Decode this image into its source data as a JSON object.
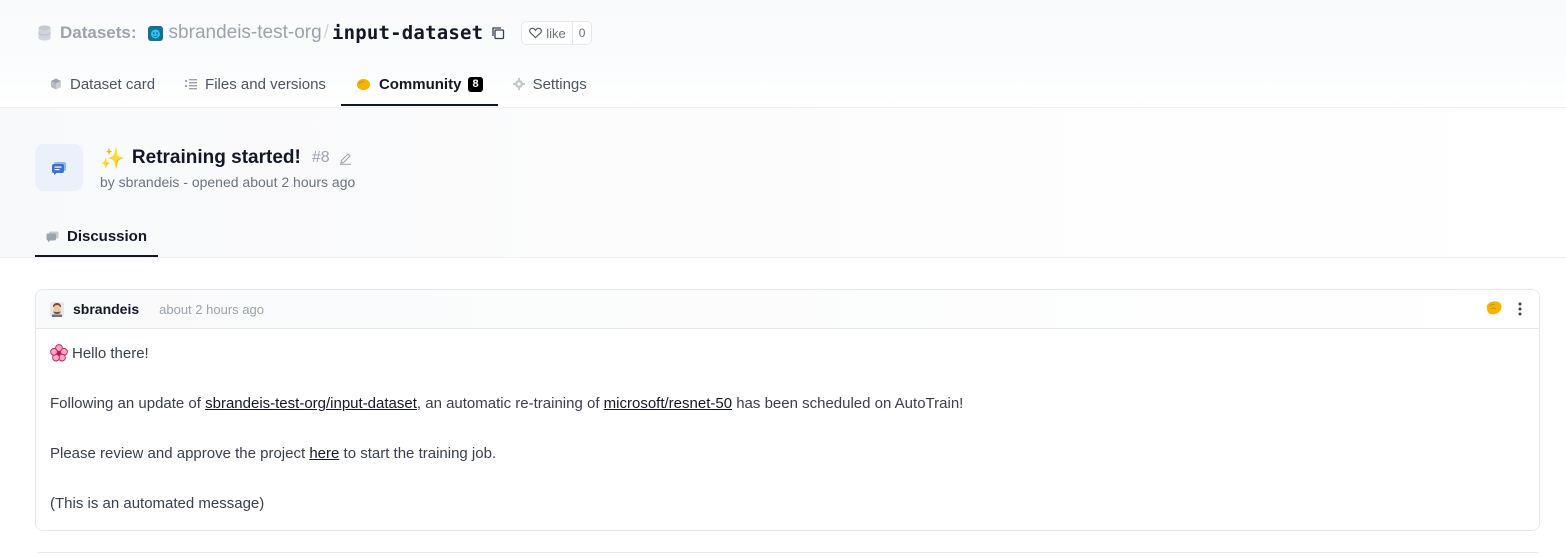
{
  "repo": {
    "section_label": "Datasets:",
    "org": "sbrandeis-test-org",
    "separator": "/",
    "name": "input-dataset",
    "like_label": "like",
    "like_count": "0"
  },
  "tabs": [
    {
      "label": "Dataset card",
      "icon": "cube-icon"
    },
    {
      "label": "Files and versions",
      "icon": "files-icon"
    },
    {
      "label": "Community",
      "icon": "community-icon",
      "badge": "8",
      "active": true
    },
    {
      "label": "Settings",
      "icon": "gear-icon"
    }
  ],
  "discussion": {
    "emoji": "✨",
    "title": "Retraining started!",
    "number": "#8",
    "meta": "by sbrandeis - opened about 2 hours ago",
    "tab_label": "Discussion"
  },
  "comment": {
    "author": "sbrandeis",
    "time": "about 2 hours ago",
    "greeting": "Hello there!",
    "line1_pre": "Following an update of ",
    "line1_link1": "sbrandeis-test-org/input-dataset",
    "line1_mid": ", an automatic re-training of ",
    "line1_link2": "microsoft/resnet-50",
    "line1_post": " has been scheduled on AutoTrain!",
    "line2_pre": "Please review and approve the project ",
    "line2_link": "here",
    "line2_post": " to start the training job.",
    "line3": "(This is an automated message)"
  },
  "colors": {
    "accent_icon_bg": "#eaf1fb",
    "badge_bg": "#000000",
    "community_icon": "#f5b400"
  }
}
